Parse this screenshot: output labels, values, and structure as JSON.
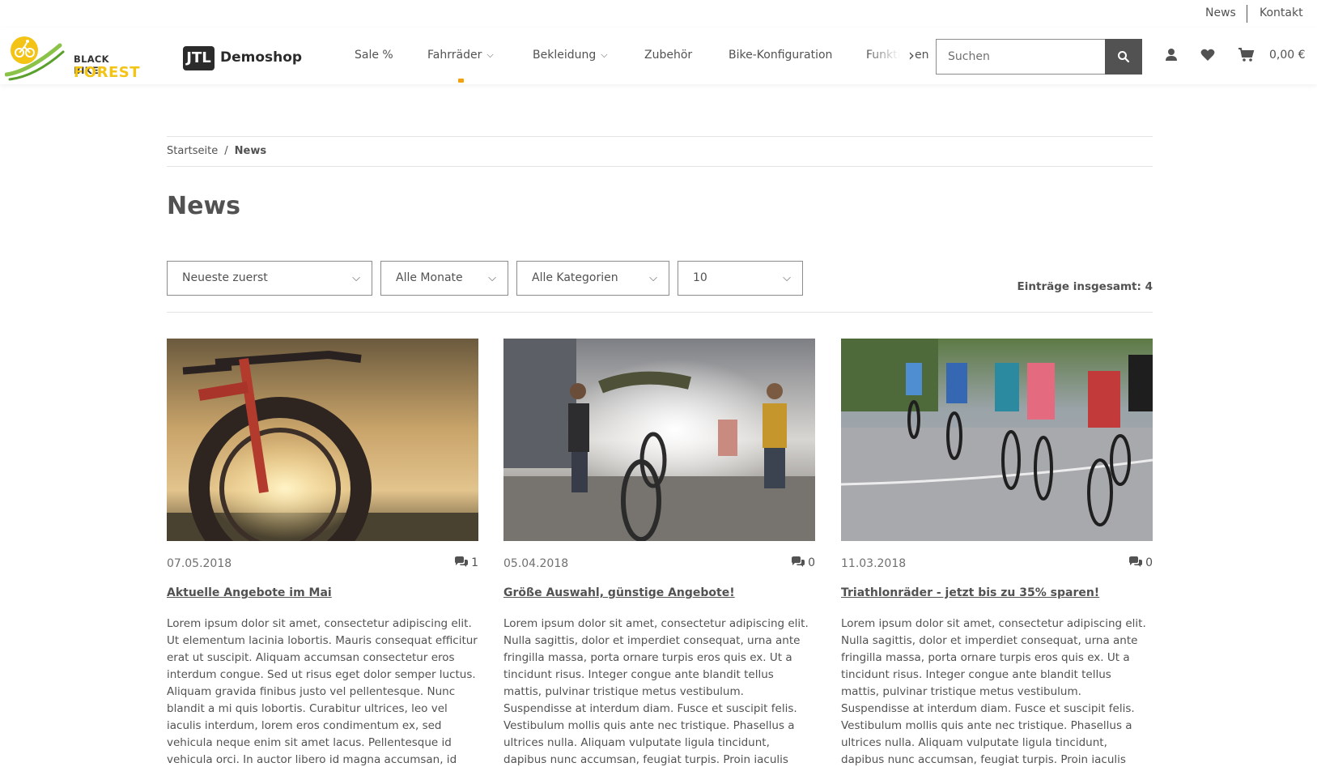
{
  "topbar": {
    "news": "News",
    "kontakt": "Kontakt"
  },
  "brand": {
    "line1": "BLACK BIKE",
    "line2": "FOREST",
    "jtl": "JTL",
    "shop": "Demoshop"
  },
  "nav": {
    "items": [
      {
        "label": "Sale %"
      },
      {
        "label": "Fahrräder"
      },
      {
        "label": "Bekleidung"
      },
      {
        "label": "Zubehör"
      },
      {
        "label": "Bike-Konfiguration"
      },
      {
        "label": "Funktionen"
      }
    ],
    "accent_color": "#f3a10c"
  },
  "search": {
    "placeholder": "Suchen"
  },
  "cart": {
    "total": "0,00 €"
  },
  "breadcrumb": {
    "home": "Startseite",
    "separator": "/",
    "current": "News"
  },
  "page": {
    "title": "News"
  },
  "filters": {
    "sort": "Neueste zuerst",
    "month": "Alle Monate",
    "category": "Alle Kategorien",
    "per_page": "10",
    "total": "Einträge insgesamt: 4"
  },
  "posts": [
    {
      "date": "07.05.2018",
      "comments": "1",
      "title": "Aktuelle Angebote im Mai",
      "text": "Lorem ipsum dolor sit amet, consectetur adipiscing elit. Ut elementum lacinia lobortis. Mauris consequat efficitur erat ut suscipit. Aliquam accumsan consectetur eros interdum congue. Sed ut risus eget dolor semper luctus. Aliquam gravida finibus justo vel pellentesque. Nunc blandit a mi quis lobortis. Curabitur ultrices, leo vel iaculis interdum, lorem eros condimentum ex, sed vehicula neque enim sit amet lacus. Pellentesque id vehicula orci. In auctor libero id magna accumsan, id finibus massa ornare. Sed et felis",
      "image": "bike-wheel-sunset-photo"
    },
    {
      "date": "05.04.2018",
      "comments": "0",
      "title": "Größe Auswahl, günstige Angebote!",
      "text": "Lorem ipsum dolor sit amet, consectetur adipiscing elit. Nulla sagittis, dolor et imperdiet consequat, urna ante fringilla massa, porta ornare turpis eros quis ex. Ut a tincidunt risus. Integer congue ante blandit tellus mattis, pulvinar tristique metus vestibulum. Suspendisse at interdum diam. Fusce et suscipit felis. Vestibulum mollis quis ante nec tristique. Phasellus a ultrices nulla. Aliquam vulputate ligula tincidunt, dapibus nunc accumsan, feugiat turpis. Proin iaculis blandit dapibus.",
      "image": "urban-cyclists-photo"
    },
    {
      "date": "11.03.2018",
      "comments": "0",
      "title": "Triathlonräder - jetzt bis zu 35% sparen!",
      "text": "Lorem ipsum dolor sit amet, consectetur adipiscing elit. Nulla sagittis, dolor et imperdiet consequat, urna ante fringilla massa, porta ornare turpis eros quis ex. Ut a tincidunt risus. Integer congue ante blandit tellus mattis, pulvinar tristique metus vestibulum. Suspendisse at interdum diam. Fusce et suscipit felis. Vestibulum mollis quis ante nec tristique. Phasellus a ultrices nulla. Aliquam vulputate ligula tincidunt, dapibus nunc accumsan, feugiat turpis. Proin iaculis blandit dapibus.",
      "image": "road-race-cyclists-photo"
    }
  ]
}
